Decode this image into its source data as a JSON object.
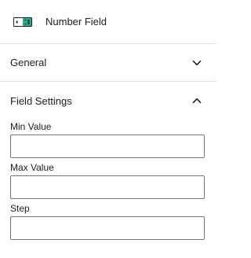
{
  "block": {
    "icon": "number-field-icon",
    "title": "Number Field"
  },
  "sections": {
    "general": {
      "title": "General",
      "expanded": false,
      "toggle_icon": "chevron-down-icon"
    },
    "field_settings": {
      "title": "Field Settings",
      "expanded": true,
      "toggle_icon": "chevron-up-icon",
      "fields": {
        "min_value": {
          "label": "Min Value",
          "value": "",
          "placeholder": ""
        },
        "max_value": {
          "label": "Max Value",
          "value": "",
          "placeholder": ""
        },
        "step": {
          "label": "Step",
          "value": "",
          "placeholder": ""
        }
      }
    }
  },
  "colors": {
    "icon_accent": "#1ab394",
    "border": "#e0e0e0",
    "input_border": "#757575"
  }
}
